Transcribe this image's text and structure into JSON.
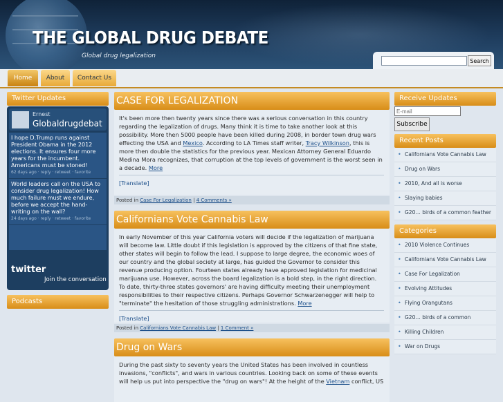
{
  "header": {
    "title": "THE GLOBAL DRUG DEBATE",
    "tagline": "Global drug legalization",
    "search_button": "Search",
    "search_placeholder": ""
  },
  "nav": [
    {
      "label": "Home"
    },
    {
      "label": "About"
    },
    {
      "label": "Contact Us"
    }
  ],
  "left": {
    "twitter_title": "Twitter Updates",
    "tw_name": "Ernest",
    "tw_handle": "Globaldrugdebat",
    "tweets": [
      {
        "text": "I hope D.Trump runs against President Obama in the 2012 elections. It ensures four more years for the incumbent. Americans must be stoned!",
        "meta": "62 days ago · reply · retweet · favorite"
      },
      {
        "text": "World leaders call on the USA to consider drug legalization! How much failure must we endure, before we accept the hand-writing on the wall?",
        "meta": "24 days ago · reply · retweet · favorite"
      }
    ],
    "twitter_logo": "twitter",
    "join": "Join the conversation",
    "podcasts_title": "Podcasts"
  },
  "posts": [
    {
      "title": "CASE FOR LEGALIZATION",
      "b1": "It's been more then twenty years since there was a serious conversation in this country regarding the legalization of drugs.  Many think it is time to take another look at this possibility.  More then 5000 people have been killed during 2008, in border town drug wars effecting the USA and ",
      "link1": "Mexico",
      "b2": ".  According to LA Times staff writer, ",
      "link2": "Tracy Wilkinson",
      "b3": ", this is more then double the statistics for the previous year.  Mexican Attorney General Eduardo Medina Mora recognizes, that corruption at the top levels of government is the worst seen in a decade.  ",
      "more": "More",
      "translate": "[Translate]",
      "meta_prefix": "Posted in ",
      "category": "Case For Legalization",
      "sep": " | ",
      "comments": "4 Comments »"
    },
    {
      "title": "Californians Vote Cannabis Law",
      "b1": "In early November of this year California voters will decide if the legalization of marijuana will become law.  Little doubt if this legislation is approved by the citizens of that fine state,  other states will begin to follow the lead.  I suppose to large degree, the economic woes of our country and the global society at large,  has guided the Governor to consider this revenue producing option.  Fourteen states already have approved legislation for medicinal marijuana use.  However,  across the board legalization is a bold step,  in the right direction.  To date, thirty-three states governors' are having difficulty meeting their unemployment responsibilities to their respective citizens.  Perhaps Governor Schwarzenegger will help to \"terminate\" the hesitation of those struggling administrations. ",
      "more": "More",
      "translate": "[Translate]",
      "meta_prefix": "Posted in ",
      "category": "Californians Vote Cannabis Law",
      "sep": " | ",
      "comments": "1 Comment »"
    },
    {
      "title": "Drug on Wars",
      "b1": "During the past sixty to seventy years the United States has been involved in countless invasions, \"conflicts\", and wars in various countries. Looking back on some of these events will help us put into perspective the \"drug on wars\"!  At the height of the ",
      "link1": "Vietnam",
      "b2": " conflict,  US"
    }
  ],
  "right": {
    "receive_title": "Receive Updates",
    "email_placeholder": "E-mail",
    "subscribe": "Subscribe",
    "recent_title": "Recent Posts",
    "recent": [
      "Californians Vote Cannabis Law",
      "Drug on Wars",
      "2010, And all is worse",
      "Slaying babies",
      "G20… birds of a common feather"
    ],
    "categories_title": "Categories",
    "categories": [
      "2010 Violence Continues",
      "Californians Vote Cannabis Law",
      "Case For Legalization",
      "Evolving Attitudes",
      "Flying Orangutans",
      "G20… birds of a common",
      "Killing Children",
      "War on Drugs"
    ]
  }
}
